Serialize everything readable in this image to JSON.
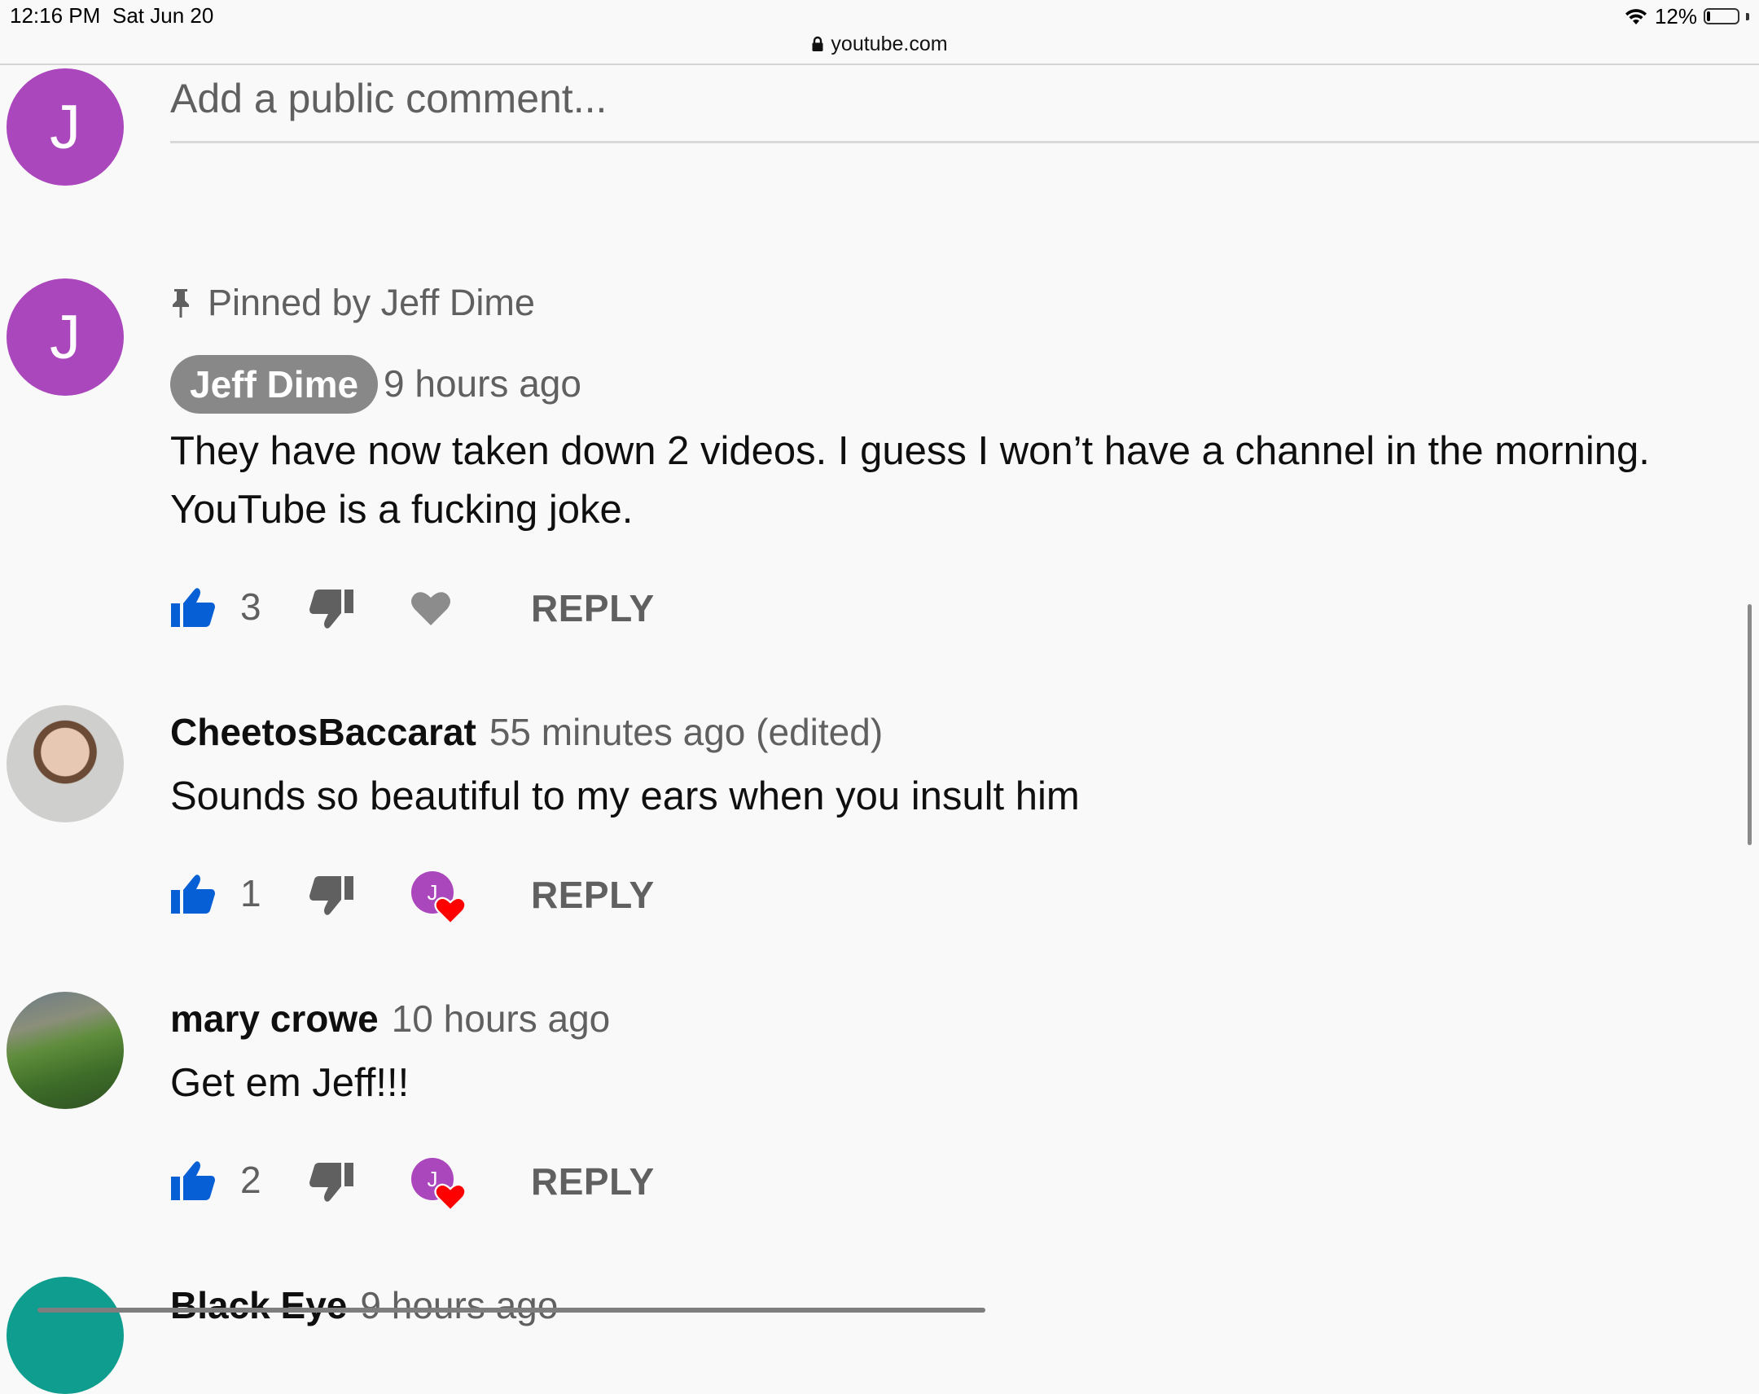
{
  "status_bar": {
    "time": "12:16 PM",
    "date": "Sat Jun 20",
    "battery": "12%",
    "battery_level": 0.12
  },
  "browser": {
    "url": "youtube.com"
  },
  "comment_box": {
    "placeholder": "Add a public comment...",
    "avatar_letter": "J"
  },
  "comments": [
    {
      "pinned_label": "Pinned by Jeff Dime",
      "author": "Jeff Dime",
      "time": "9 hours ago",
      "text_line1": "They have now taken down 2 videos.  I guess I won’t have a channel in the morning.",
      "text_line2": "YouTube is a fucking joke.",
      "likes": "3",
      "reply": "REPLY",
      "avatar_letter": "J"
    },
    {
      "author": "CheetosBaccarat",
      "time": "55 minutes ago (edited)",
      "text": "Sounds so beautiful to my ears when you insult him",
      "likes": "1",
      "reply": "REPLY",
      "heart_avatar_letter": "J"
    },
    {
      "author": "mary crowe",
      "time": "10 hours ago",
      "text": "Get em Jeff!!!",
      "likes": "2",
      "reply": "REPLY",
      "heart_avatar_letter": "J"
    },
    {
      "author": "Black Eye",
      "time": "9 hours ago"
    }
  ],
  "colors": {
    "like_blue": "#065fd4",
    "avatar_purple": "#ab47bc",
    "heart_red": "#ff0000",
    "secondary_text": "#606060"
  }
}
